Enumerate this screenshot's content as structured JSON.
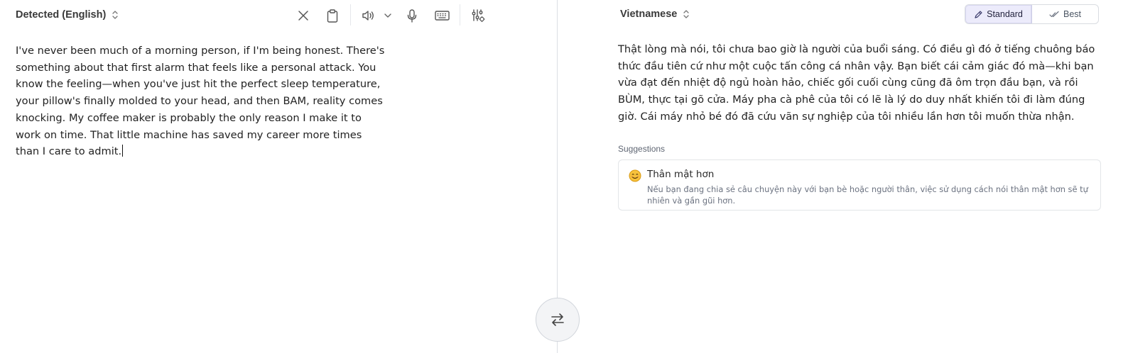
{
  "source": {
    "language_label": "Detected (English)",
    "text": "I've never been much of a morning person, if I'm being honest. There's something about that first alarm that feels like a personal attack. You know the feeling—when you've just hit the perfect sleep temperature, your pillow's finally molded to your head, and then BAM, reality comes knocking. My coffee maker is probably the only reason I make it to work on time. That little machine has saved my career more times than I care to admit.",
    "toolbar": {
      "icons": [
        "close-icon",
        "clipboard-icon",
        "speaker-icon",
        "chevron-down-icon",
        "microphone-icon",
        "keyboard-icon",
        "settings-sliders-icon"
      ]
    }
  },
  "swap": {
    "icon": "swap-arrows-icon"
  },
  "target": {
    "language_label": "Vietnamese",
    "modes": {
      "standard": {
        "label": "Standard",
        "icon": "pen-icon",
        "selected": true
      },
      "best": {
        "label": "Best",
        "icon": "double-check-icon",
        "selected": false
      }
    },
    "text": "Thật lòng mà nói, tôi chưa bao giờ là người của buổi sáng. Có điều gì đó ở tiếng chuông báo thức đầu tiên cứ như một cuộc tấn công cá nhân vậy. Bạn biết cái cảm giác đó mà—khi bạn vừa đạt đến nhiệt độ ngủ hoàn hảo, chiếc gối cuối cùng cũng đã ôm trọn đầu bạn, và rồi BÙM, thực tại gõ cửa. Máy pha cà phê của tôi có lẽ là lý do duy nhất khiến tôi đi làm đúng giờ. Cái máy nhỏ bé đó đã cứu vãn sự nghiệp của tôi nhiều lần hơn tôi muốn thừa nhận.",
    "suggestions_label": "Suggestions",
    "suggestions": [
      {
        "icon": "smile-emoji-icon",
        "title": "Thân mật hơn",
        "description": "Nếu bạn đang chia sẻ câu chuyện này với bạn bè hoặc người thân, việc sử dụng cách nói thân mật hơn sẽ tự nhiên và gần gũi hơn."
      }
    ]
  },
  "colors": {
    "accent_selected_bg": "#ecebfb",
    "divider": "#dcdfe3",
    "emoji_yellow": "#f7c23c"
  }
}
